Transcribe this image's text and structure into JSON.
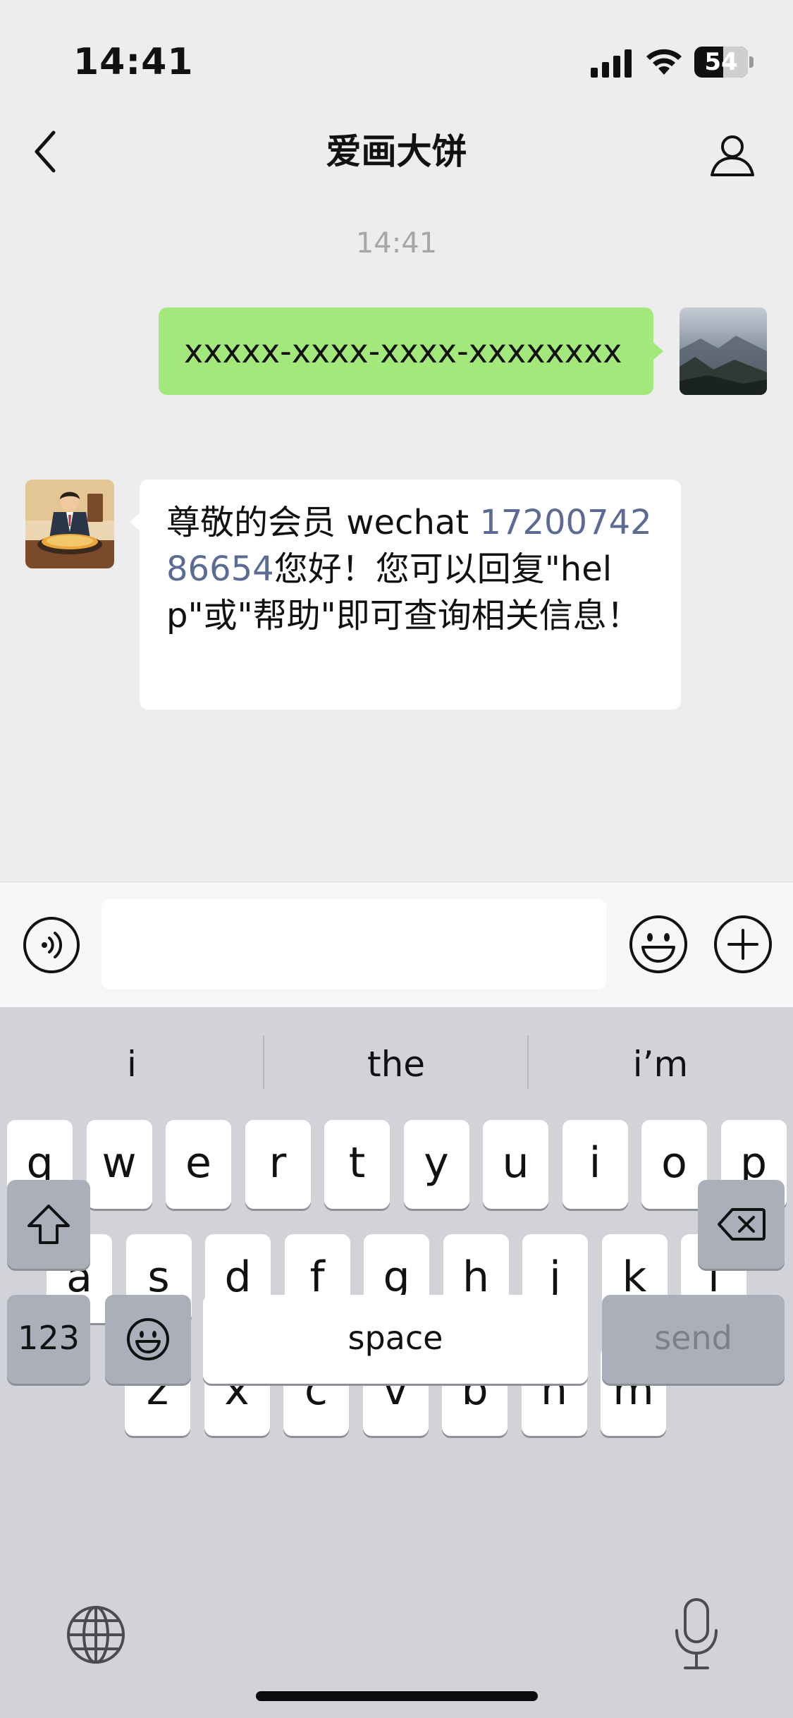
{
  "status_bar": {
    "time": "14:41",
    "battery": "54",
    "battery_level": 0.54
  },
  "nav": {
    "title": "爱画大饼"
  },
  "chat": {
    "timestamp": "14:41",
    "messages": [
      {
        "from": "me",
        "text": "xxxxx-xxxx-xxxx-xxxxxxxx"
      },
      {
        "from": "other",
        "text_before": "尊敬的会员 wechat ",
        "link": "1720074286654",
        "text_after": "您好！您可以回复\"help\"或\"帮助\"即可查询相关信息！"
      }
    ]
  },
  "input": {
    "value": "",
    "placeholder": ""
  },
  "keyboard": {
    "suggestions": [
      "i",
      "the",
      "i’m"
    ],
    "row1": [
      "q",
      "w",
      "e",
      "r",
      "t",
      "y",
      "u",
      "i",
      "o",
      "p"
    ],
    "row2": [
      "a",
      "s",
      "d",
      "f",
      "g",
      "h",
      "j",
      "k",
      "l"
    ],
    "row3": [
      "z",
      "x",
      "c",
      "v",
      "b",
      "n",
      "m"
    ],
    "numbers_label": "123",
    "space_label": "space",
    "send_label": "send"
  },
  "colors": {
    "chat_background": "#ededed",
    "my_bubble": "#a2e87a",
    "other_bubble": "#ffffff",
    "link": "#5b6b94",
    "keyboard_background": "#d1d3d9"
  },
  "icons": [
    "signal-icon",
    "wifi-icon",
    "battery-icon",
    "back-icon",
    "profile-icon",
    "voice-icon",
    "emoji-icon",
    "plus-icon",
    "shift-icon",
    "delete-icon",
    "globe-icon",
    "mic-icon"
  ]
}
